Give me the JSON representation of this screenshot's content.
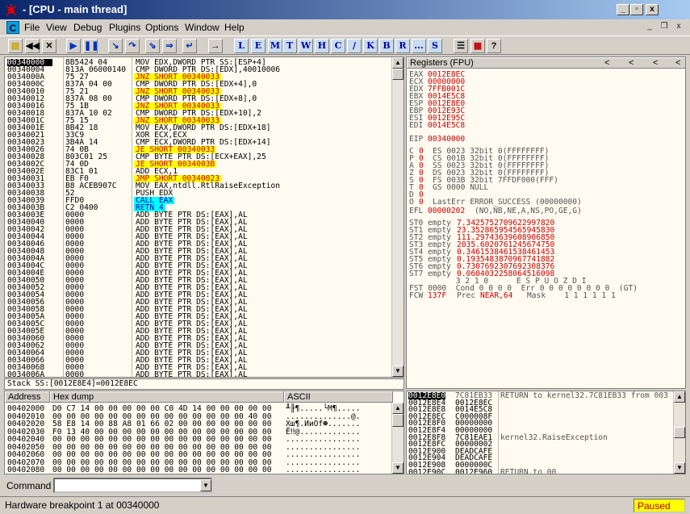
{
  "window": {
    "title": "- [CPU - main thread]",
    "controls": [
      "_",
      "▫",
      "x"
    ]
  },
  "menu": {
    "items": [
      "File",
      "View",
      "Debug",
      "Plugins",
      "Options",
      "Window",
      "Help"
    ],
    "mdi_controls": [
      "_",
      "❐",
      "x"
    ]
  },
  "toolbar": {
    "icons": [
      "open-icon",
      "rewind-icon",
      "close-icon",
      "run-icon",
      "pause-icon",
      "step-into-icon",
      "step-over-icon",
      "trace-into-icon",
      "trace-over-icon",
      "execute-till-return-icon",
      "goto-icon"
    ],
    "letters": [
      "L",
      "E",
      "M",
      "T",
      "W",
      "H",
      "C",
      "/",
      "K",
      "B",
      "R",
      "...",
      "S"
    ]
  },
  "disasm": {
    "rows": [
      {
        "addr": "00340000",
        "hex": "8B5424 04",
        "cmd": "MOV EDX,DWORD PTR SS:[ESP+4]",
        "hl": ""
      },
      {
        "addr": "00340004",
        "hex": "813A 06000140",
        "cmd": "CMP DWORD PTR DS:[EDX],40010006",
        "hl": ""
      },
      {
        "addr": "0034000A",
        "hex": "75 27",
        "cmd": "JNZ SHORT 00340033",
        "hl": "yellow"
      },
      {
        "addr": "0034000C",
        "hex": "837A 04 00",
        "cmd": "CMP DWORD PTR DS:[EDX+4],0",
        "hl": ""
      },
      {
        "addr": "00340010",
        "hex": "75 21",
        "cmd": "JNZ SHORT 00340033",
        "hl": "yellow"
      },
      {
        "addr": "00340012",
        "hex": "837A 08 00",
        "cmd": "CMP DWORD PTR DS:[EDX+8],0",
        "hl": ""
      },
      {
        "addr": "00340016",
        "hex": "75 1B",
        "cmd": "JNZ SHORT 00340033",
        "hl": "yellow"
      },
      {
        "addr": "00340018",
        "hex": "837A 10 02",
        "cmd": "CMP DWORD PTR DS:[EDX+10],2",
        "hl": ""
      },
      {
        "addr": "0034001C",
        "hex": "75 15",
        "cmd": "JNZ SHORT 00340033",
        "hl": "yellow"
      },
      {
        "addr": "0034001E",
        "hex": "8B42 18",
        "cmd": "MOV EAX,DWORD PTR DS:[EDX+18]",
        "hl": ""
      },
      {
        "addr": "00340021",
        "hex": "33C9",
        "cmd": "XOR ECX,ECX",
        "hl": ""
      },
      {
        "addr": "00340023",
        "hex": "3B4A 14",
        "cmd": "CMP ECX,DWORD PTR DS:[EDX+14]",
        "hl": ""
      },
      {
        "addr": "00340026",
        "hex": "74 0B",
        "cmd": "JE SHORT 00340033",
        "hl": "yellow"
      },
      {
        "addr": "00340028",
        "hex": "803C01 25",
        "cmd": "CMP BYTE PTR DS:[ECX+EAX],25",
        "hl": ""
      },
      {
        "addr": "0034002C",
        "hex": "74 0D",
        "cmd": "JE SHORT 0034003B",
        "hl": "yellow"
      },
      {
        "addr": "0034002E",
        "hex": "83C1 01",
        "cmd": "ADD ECX,1",
        "hl": ""
      },
      {
        "addr": "00340031",
        "hex": "EB F0",
        "cmd": "JMP SHORT 00340023",
        "hl": "yellow"
      },
      {
        "addr": "00340033",
        "hex": "B8 ACEB907C",
        "cmd": "MOV EAX,ntdll.RtlRaiseException",
        "hl": ""
      },
      {
        "addr": "00340038",
        "hex": "52",
        "cmd": "PUSH EDX",
        "hl": ""
      },
      {
        "addr": "00340039",
        "hex": "FFD0",
        "cmd": "CALL EAX",
        "hl": "cyan"
      },
      {
        "addr": "0034003B",
        "hex": "C2 0400",
        "cmd": "RETN 4",
        "hl": "cyan"
      },
      {
        "addr": "0034003E",
        "hex": "0000",
        "cmd": "ADD BYTE PTR DS:[EAX],AL",
        "hl": ""
      },
      {
        "addr": "00340040",
        "hex": "0000",
        "cmd": "ADD BYTE PTR DS:[EAX],AL",
        "hl": ""
      },
      {
        "addr": "00340042",
        "hex": "0000",
        "cmd": "ADD BYTE PTR DS:[EAX],AL",
        "hl": ""
      },
      {
        "addr": "00340044",
        "hex": "0000",
        "cmd": "ADD BYTE PTR DS:[EAX],AL",
        "hl": ""
      },
      {
        "addr": "00340046",
        "hex": "0000",
        "cmd": "ADD BYTE PTR DS:[EAX],AL",
        "hl": ""
      },
      {
        "addr": "00340048",
        "hex": "0000",
        "cmd": "ADD BYTE PTR DS:[EAX],AL",
        "hl": ""
      },
      {
        "addr": "0034004A",
        "hex": "0000",
        "cmd": "ADD BYTE PTR DS:[EAX],AL",
        "hl": ""
      },
      {
        "addr": "0034004C",
        "hex": "0000",
        "cmd": "ADD BYTE PTR DS:[EAX],AL",
        "hl": ""
      },
      {
        "addr": "0034004E",
        "hex": "0000",
        "cmd": "ADD BYTE PTR DS:[EAX],AL",
        "hl": ""
      },
      {
        "addr": "00340050",
        "hex": "0000",
        "cmd": "ADD BYTE PTR DS:[EAX],AL",
        "hl": ""
      },
      {
        "addr": "00340052",
        "hex": "0000",
        "cmd": "ADD BYTE PTR DS:[EAX],AL",
        "hl": ""
      },
      {
        "addr": "00340054",
        "hex": "0000",
        "cmd": "ADD BYTE PTR DS:[EAX],AL",
        "hl": ""
      },
      {
        "addr": "00340056",
        "hex": "0000",
        "cmd": "ADD BYTE PTR DS:[EAX],AL",
        "hl": ""
      },
      {
        "addr": "00340058",
        "hex": "0000",
        "cmd": "ADD BYTE PTR DS:[EAX],AL",
        "hl": ""
      },
      {
        "addr": "0034005A",
        "hex": "0000",
        "cmd": "ADD BYTE PTR DS:[EAX],AL",
        "hl": ""
      },
      {
        "addr": "0034005C",
        "hex": "0000",
        "cmd": "ADD BYTE PTR DS:[EAX],AL",
        "hl": ""
      },
      {
        "addr": "0034005E",
        "hex": "0000",
        "cmd": "ADD BYTE PTR DS:[EAX],AL",
        "hl": ""
      },
      {
        "addr": "00340060",
        "hex": "0000",
        "cmd": "ADD BYTE PTR DS:[EAX],AL",
        "hl": ""
      },
      {
        "addr": "00340062",
        "hex": "0000",
        "cmd": "ADD BYTE PTR DS:[EAX],AL",
        "hl": ""
      },
      {
        "addr": "00340064",
        "hex": "0000",
        "cmd": "ADD BYTE PTR DS:[EAX],AL",
        "hl": ""
      },
      {
        "addr": "00340066",
        "hex": "0000",
        "cmd": "ADD BYTE PTR DS:[EAX],AL",
        "hl": ""
      },
      {
        "addr": "00340068",
        "hex": "0000",
        "cmd": "ADD BYTE PTR DS:[EAX],AL",
        "hl": ""
      },
      {
        "addr": "0034006A",
        "hex": "0000",
        "cmd": "ADD BYTE PTR DS:[EAX],AL",
        "hl": ""
      }
    ]
  },
  "info_line": "Stack SS:[0012E8E4]=0012E8EC",
  "registers": {
    "header": "Registers (FPU)",
    "nav": [
      "<",
      "<",
      "<",
      "<"
    ],
    "gp": [
      {
        "name": "EAX",
        "value": "0012E8EC"
      },
      {
        "name": "ECX",
        "value": "00000000"
      },
      {
        "name": "EDX",
        "value": "7FFB001C"
      },
      {
        "name": "EBX",
        "value": "0014E5C8"
      },
      {
        "name": "ESP",
        "value": "0012E8E0"
      },
      {
        "name": "EBP",
        "value": "0012E93C"
      },
      {
        "name": "ESI",
        "value": "0012E95C"
      },
      {
        "name": "EDI",
        "value": "0014E5C8"
      }
    ],
    "eip": {
      "name": "EIP",
      "value": "00340000"
    },
    "flags": [
      {
        "flag": "C",
        "val": "0",
        "seg": "ES 0023 32bit 0(FFFFFFFF)"
      },
      {
        "flag": "P",
        "val": "0",
        "seg": "CS 001B 32bit 0(FFFFFFFF)"
      },
      {
        "flag": "A",
        "val": "0",
        "seg": "SS 0023 32bit 0(FFFFFFFF)"
      },
      {
        "flag": "Z",
        "val": "0",
        "seg": "DS 0023 32bit 0(FFFFFFFF)"
      },
      {
        "flag": "S",
        "val": "0",
        "seg": "FS 003B 32bit 7FFDF000(FFF)"
      },
      {
        "flag": "T",
        "val": "0",
        "seg": "GS 0000 NULL"
      },
      {
        "flag": "D",
        "val": "0",
        "seg": ""
      },
      {
        "flag": "O",
        "val": "0",
        "seg": "LastErr ERROR_SUCCESS (00000000)"
      }
    ],
    "efl": {
      "name": "EFL",
      "value": "00000202",
      "desc": "(NO,NB,NE,A,NS,PO,GE,G)"
    },
    "fpu": [
      {
        "name": "ST0",
        "state": "empty",
        "value": "7.3425752709622997820"
      },
      {
        "name": "ST1",
        "state": "empty",
        "value": "23.352865954565945830"
      },
      {
        "name": "ST2",
        "state": "empty",
        "value": "111.29743639608906850"
      },
      {
        "name": "ST3",
        "state": "empty",
        "value": "2035.6020761245674750"
      },
      {
        "name": "ST4",
        "state": "empty",
        "value": "0.3461538461538461453"
      },
      {
        "name": "ST5",
        "state": "empty",
        "value": "0.1935483870967741882"
      },
      {
        "name": "ST6",
        "state": "empty",
        "value": "0.7307692307692308376"
      },
      {
        "name": "ST7",
        "state": "empty",
        "value": "0.0604032258064516098"
      }
    ],
    "fpu_bits_hdr": "          3 2 1 0      E S P U O Z D I",
    "fst": "FST 0000  Cond 0 0 0 0  Err 0 0 0 0 0 0 0 0  (GT)",
    "fcw_label": "FCW",
    "fcw_value": "137F",
    "fcw_prec": "Prec",
    "fcw_prec_value": "NEAR,64",
    "fcw_mask": "Mask    1 1 1 1 1 1"
  },
  "dump": {
    "headers": {
      "address": "Address",
      "hex": "Hex dump",
      "ascii": "ASCII"
    },
    "rows": [
      {
        "addr": "00402000",
        "hex": "D0 C7 14 00 00 00 00 00 C0 4D 14 00 00 00 00 00",
        "ascii": "╨╟¶.....└M¶....."
      },
      {
        "addr": "00402010",
        "hex": "00 00 00 00 00 00 00 00 00 00 00 00 00 00 40 00",
        "ascii": "..............@."
      },
      {
        "addr": "00402020",
        "hex": "58 E8 14 00 88 A8 01 66 02 00 00 00 00 00 00 00",
        "ascii": "Xш¶.ИиOf☻......."
      },
      {
        "addr": "00402030",
        "hex": "F0 13 40 00 00 00 00 00 00 00 00 00 00 00 00 00",
        "ascii": "Ё‼@............."
      },
      {
        "addr": "00402040",
        "hex": "00 00 00 00 00 00 00 00 00 00 00 00 00 00 00 00",
        "ascii": "................"
      },
      {
        "addr": "00402050",
        "hex": "00 00 00 00 00 00 00 00 00 00 00 00 00 00 00 00",
        "ascii": "................"
      },
      {
        "addr": "00402060",
        "hex": "00 00 00 00 00 00 00 00 00 00 00 00 00 00 00 00",
        "ascii": "................"
      },
      {
        "addr": "00402070",
        "hex": "00 00 00 00 00 00 00 00 00 00 00 00 00 00 00 00",
        "ascii": "................"
      },
      {
        "addr": "00402080",
        "hex": "00 00 00 00 00 00 00 00 00 00 00 00 00 00 00 00",
        "ascii": "................"
      }
    ]
  },
  "stack": {
    "rows": [
      {
        "addr": "0012E8E0",
        "val": "7C81EB33",
        "comment": "RETURN to kernel32.7C81EB33 from 003"
      },
      {
        "addr": "0012E8E4",
        "val": "0012E8EC",
        "comment": ""
      },
      {
        "addr": "0012E8E8",
        "val": "0014E5C8",
        "comment": ""
      },
      {
        "addr": "0012E8EC",
        "val": "C000008F",
        "comment": ""
      },
      {
        "addr": "0012E8F0",
        "val": "00000000",
        "comment": ""
      },
      {
        "addr": "0012E8F4",
        "val": "00000000",
        "comment": ""
      },
      {
        "addr": "0012E8F8",
        "val": "7C81EAE1",
        "comment": "kernel32.RaiseException"
      },
      {
        "addr": "0012E8FC",
        "val": "00000002",
        "comment": ""
      },
      {
        "addr": "0012E900",
        "val": "DEADCAFE",
        "comment": ""
      },
      {
        "addr": "0012E904",
        "val": "DEADCAFE",
        "comment": ""
      },
      {
        "addr": "0012E908",
        "val": "0000000C",
        "comment": ""
      },
      {
        "addr": "0012E90C",
        "val": "0012E960",
        "comment": "RETURN to 00"
      }
    ]
  },
  "command": {
    "label": "Command :",
    "value": ""
  },
  "status": {
    "text": "Hardware breakpoint 1 at 00340000",
    "state": "Paused"
  },
  "colors": {
    "yellow_hl": "#ffff00",
    "cyan_hl": "#00ffff",
    "red_value": "#d00000",
    "pane_bg": "#fffbf0",
    "stack_sel": "#000000"
  }
}
